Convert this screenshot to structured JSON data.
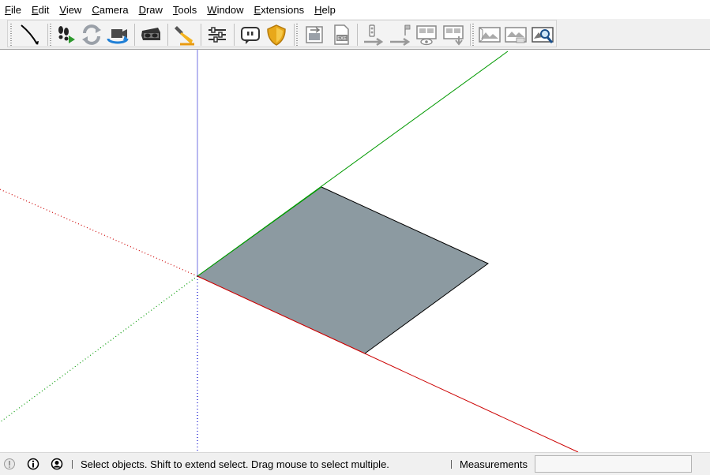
{
  "menubar": {
    "items": [
      {
        "label": "File",
        "underline": "F",
        "rest": "ile"
      },
      {
        "label": "Edit",
        "underline": "E",
        "rest": "dit"
      },
      {
        "label": "View",
        "underline": "V",
        "rest": "iew"
      },
      {
        "label": "Camera",
        "underline": "C",
        "rest": "amera"
      },
      {
        "label": "Draw",
        "underline": "D",
        "rest": "raw"
      },
      {
        "label": "Tools",
        "underline": "T",
        "rest": "ools"
      },
      {
        "label": "Window",
        "underline": "W",
        "rest": "indow"
      },
      {
        "label": "Extensions",
        "underline": "E",
        "rest": "xtensions"
      },
      {
        "label": "Help",
        "underline": "H",
        "rest": "elp"
      }
    ]
  },
  "toolbar": {
    "buttons": [
      "select-tool",
      "footprint-walk",
      "orbit",
      "camera-video",
      "vr-headset",
      "flashlight",
      "sliders-settings",
      "chat-bubble",
      "shield-gold",
      "export-image",
      "export-exe",
      "traffic-light-path",
      "flag-path",
      "scene-preview",
      "scene-download",
      "panorama-a",
      "panorama-b",
      "panorama-search"
    ]
  },
  "viewport": {
    "face_color": "#8c9aa1",
    "axis_colors": {
      "red": "#cc0000",
      "green": "#009900",
      "blue": "#0000cc"
    }
  },
  "statusbar": {
    "message": "Select objects. Shift to extend select. Drag mouse to select multiple.",
    "measurements_label": "Measurements",
    "measurements_value": ""
  }
}
